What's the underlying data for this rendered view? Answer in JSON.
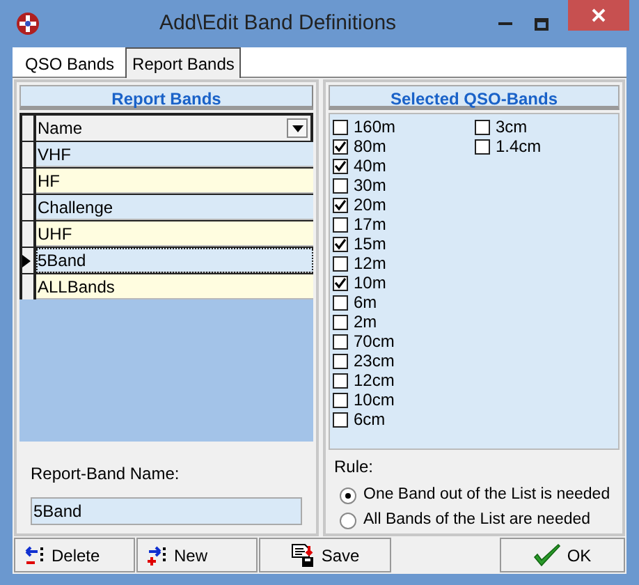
{
  "window": {
    "title": "Add\\Edit Band Definitions"
  },
  "tabs": [
    {
      "label": "QSO Bands",
      "selected": false
    },
    {
      "label": "Report Bands",
      "selected": true
    }
  ],
  "report_bands": {
    "header": "Report Bands",
    "column": "Name",
    "rows": [
      {
        "name": "VHF",
        "selected": false
      },
      {
        "name": "HF",
        "selected": false
      },
      {
        "name": "Challenge",
        "selected": false
      },
      {
        "name": "UHF",
        "selected": false
      },
      {
        "name": "5Band",
        "selected": true
      },
      {
        "name": "ALLBands",
        "selected": false
      }
    ],
    "name_label": "Report-Band Name:",
    "name_value": "5Band"
  },
  "selected_qso_bands": {
    "header": "Selected QSO-Bands",
    "columns": [
      [
        {
          "label": "160m",
          "checked": false
        },
        {
          "label": "80m",
          "checked": true
        },
        {
          "label": "40m",
          "checked": true
        },
        {
          "label": "30m",
          "checked": false
        },
        {
          "label": "20m",
          "checked": true
        },
        {
          "label": "17m",
          "checked": false
        },
        {
          "label": "15m",
          "checked": true
        },
        {
          "label": "12m",
          "checked": false
        },
        {
          "label": "10m",
          "checked": true
        },
        {
          "label": "6m",
          "checked": false
        },
        {
          "label": "2m",
          "checked": false
        },
        {
          "label": "70cm",
          "checked": false
        },
        {
          "label": "23cm",
          "checked": false
        },
        {
          "label": "12cm",
          "checked": false
        },
        {
          "label": "10cm",
          "checked": false
        },
        {
          "label": "6cm",
          "checked": false
        }
      ],
      [
        {
          "label": "3cm",
          "checked": false
        },
        {
          "label": "1.4cm",
          "checked": false
        }
      ]
    ],
    "rule_label": "Rule:",
    "rules": [
      {
        "label": "One Band out of the List is needed",
        "selected": true
      },
      {
        "label": "All Bands of the List are needed",
        "selected": false
      }
    ]
  },
  "buttons": [
    {
      "kind": "delete",
      "label": "Delete"
    },
    {
      "kind": "new",
      "label": "New"
    },
    {
      "kind": "save",
      "label": "Save"
    },
    {
      "kind": "ok",
      "label": "OK"
    }
  ]
}
